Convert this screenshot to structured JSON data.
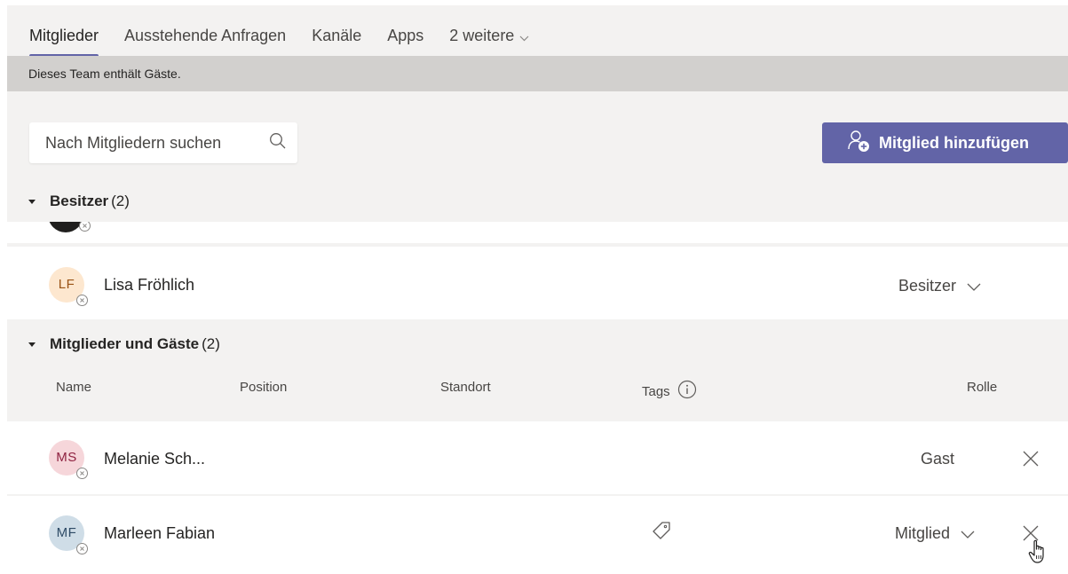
{
  "tabs": [
    {
      "label": "Mitglieder",
      "active": true
    },
    {
      "label": "Ausstehende Anfragen",
      "active": false
    },
    {
      "label": "Kanäle",
      "active": false
    },
    {
      "label": "Apps",
      "active": false
    },
    {
      "label": "2 weitere",
      "active": false
    }
  ],
  "banner": {
    "text": "Dieses Team enthält Gäste."
  },
  "search": {
    "placeholder": "Nach Mitgliedern suchen"
  },
  "add_button": {
    "label": "Mitglied hinzufügen"
  },
  "owners": {
    "title": "Besitzer",
    "count": "(2)",
    "members": [
      {
        "initials": "LF",
        "name": "Lisa Fröhlich",
        "role": "Besitzer"
      }
    ]
  },
  "guests": {
    "title": "Mitglieder und Gäste",
    "count": "(2)",
    "columns": {
      "name": "Name",
      "position": "Position",
      "location": "Standort",
      "tags": "Tags",
      "role": "Rolle"
    },
    "members": [
      {
        "initials": "MS",
        "name": "Melanie Sch...",
        "role": "Gast"
      },
      {
        "initials": "MF",
        "name": "Marleen Fabian",
        "role": "Mitglied"
      }
    ]
  },
  "colors": {
    "accent": "#6264a7",
    "avatar_lf_bg": "#fde7cf",
    "avatar_lf_fg": "#9a5315",
    "avatar_ms_bg": "#f6d6da",
    "avatar_ms_fg": "#8f2240",
    "avatar_mf_bg": "#cfdde7",
    "avatar_mf_fg": "#2e4b66"
  }
}
